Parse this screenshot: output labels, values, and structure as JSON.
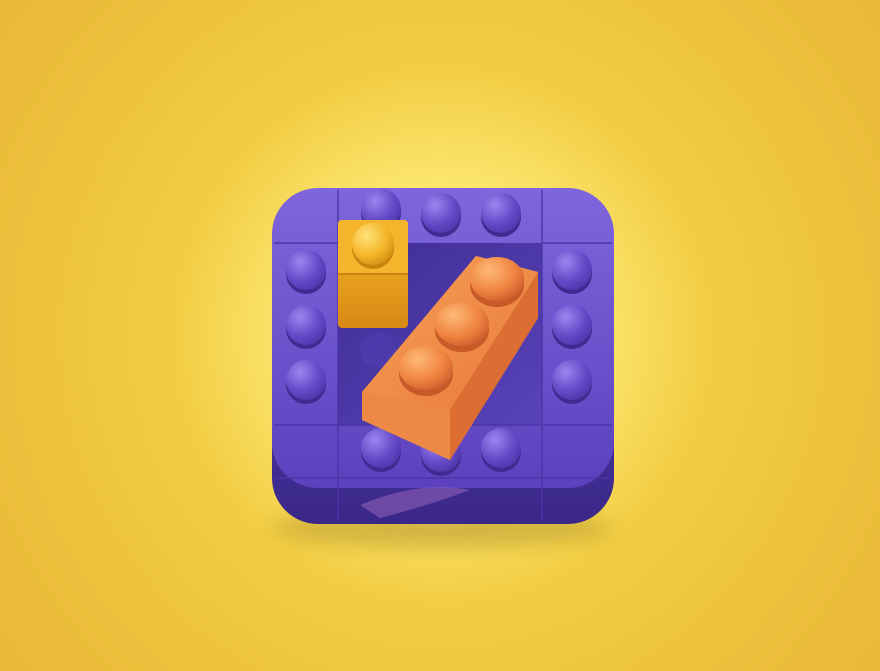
{
  "scene": {
    "background_colors": [
      "#fffb98",
      "#f2cd43",
      "#e6b534"
    ],
    "icon": {
      "name": "lego-brick-puzzle-icon",
      "frame_color": "#6a4fc9",
      "frame_shadow_color": "#3b2a8a",
      "inner_floor_color": "#4a36a8"
    },
    "bricks": [
      {
        "name": "small-yellow-brick",
        "color": "#f0a81e",
        "studs": 1
      },
      {
        "name": "long-orange-brick",
        "color": "#f08a3a",
        "studs": 3
      }
    ]
  }
}
